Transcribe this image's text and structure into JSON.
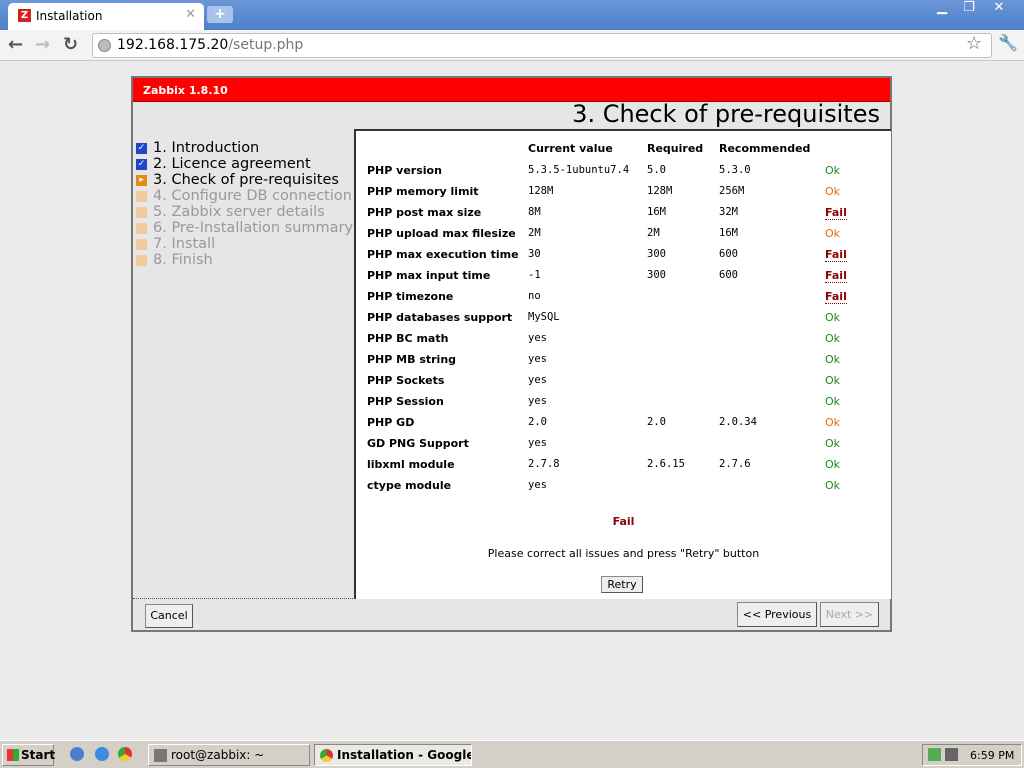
{
  "browser": {
    "tab_title": "Installation",
    "tab_favicon": "Z",
    "url_host": "192.168.175.20",
    "url_path": "/setup.php"
  },
  "wizard": {
    "product": "Zabbix 1.8.10",
    "title": "3. Check of pre-requisites",
    "steps": [
      {
        "label": "1. Introduction",
        "state": "done"
      },
      {
        "label": "2. Licence agreement",
        "state": "done"
      },
      {
        "label": "3. Check of pre-requisites",
        "state": "current"
      },
      {
        "label": "4. Configure DB connection",
        "state": "todo"
      },
      {
        "label": "5. Zabbix server details",
        "state": "todo"
      },
      {
        "label": "6. Pre-Installation summary",
        "state": "todo"
      },
      {
        "label": "7. Install",
        "state": "todo"
      },
      {
        "label": "8. Finish",
        "state": "todo"
      }
    ],
    "columns": {
      "current": "Current value",
      "required": "Required",
      "recommended": "Recommended"
    },
    "rows": [
      {
        "name": "PHP version",
        "current": "5.3.5-1ubuntu7.4",
        "required": "5.0",
        "recommended": "5.3.0",
        "status": "Ok",
        "level": "ok"
      },
      {
        "name": "PHP memory limit",
        "current": "128M",
        "required": "128M",
        "recommended": "256M",
        "status": "Ok",
        "level": "warn"
      },
      {
        "name": "PHP post max size",
        "current": "8M",
        "required": "16M",
        "recommended": "32M",
        "status": "Fail",
        "level": "fail"
      },
      {
        "name": "PHP upload max filesize",
        "current": "2M",
        "required": "2M",
        "recommended": "16M",
        "status": "Ok",
        "level": "warn"
      },
      {
        "name": "PHP max execution time",
        "current": "30",
        "required": "300",
        "recommended": "600",
        "status": "Fail",
        "level": "fail"
      },
      {
        "name": "PHP max input time",
        "current": "-1",
        "required": "300",
        "recommended": "600",
        "status": "Fail",
        "level": "fail"
      },
      {
        "name": "PHP timezone",
        "current": "no",
        "required": "",
        "recommended": "",
        "status": "Fail",
        "level": "fail"
      },
      {
        "name": "PHP databases support",
        "current": "MySQL",
        "required": "",
        "recommended": "",
        "status": "Ok",
        "level": "ok"
      },
      {
        "name": "PHP BC math",
        "current": "yes",
        "required": "",
        "recommended": "",
        "status": "Ok",
        "level": "ok"
      },
      {
        "name": "PHP MB string",
        "current": "yes",
        "required": "",
        "recommended": "",
        "status": "Ok",
        "level": "ok"
      },
      {
        "name": "PHP Sockets",
        "current": "yes",
        "required": "",
        "recommended": "",
        "status": "Ok",
        "level": "ok"
      },
      {
        "name": "PHP Session",
        "current": "yes",
        "required": "",
        "recommended": "",
        "status": "Ok",
        "level": "ok"
      },
      {
        "name": "PHP GD",
        "current": "2.0",
        "required": "2.0",
        "recommended": "2.0.34",
        "status": "Ok",
        "level": "warn"
      },
      {
        "name": "GD PNG Support",
        "current": "yes",
        "required": "",
        "recommended": "",
        "status": "Ok",
        "level": "ok"
      },
      {
        "name": "libxml module",
        "current": "2.7.8",
        "required": "2.6.15",
        "recommended": "2.7.6",
        "status": "Ok",
        "level": "ok"
      },
      {
        "name": "ctype module",
        "current": "yes",
        "required": "",
        "recommended": "",
        "status": "Ok",
        "level": "ok"
      }
    ],
    "overall": "Fail",
    "message": "Please correct all issues and press \"Retry\" button",
    "retry": "Retry",
    "cancel": "Cancel",
    "previous": "<< Previous",
    "next": "Next >>"
  },
  "taskbar": {
    "start": "Start",
    "tasks": [
      "root@zabbix: ~",
      "Installation - Google ..."
    ],
    "clock": "6:59 PM"
  }
}
